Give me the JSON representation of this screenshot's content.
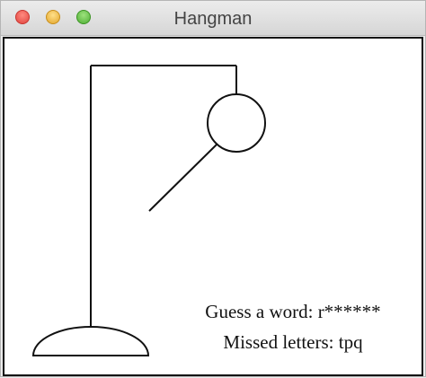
{
  "window": {
    "title": "Hangman",
    "buttons": [
      {
        "name": "close",
        "color": "#e0443e"
      },
      {
        "name": "minimize",
        "color": "#e2a52b"
      },
      {
        "name": "zoom",
        "color": "#4fae35"
      }
    ]
  },
  "game": {
    "word_label": "Guess a word:",
    "masked_word": "r******",
    "word_text": "Guess a word: r******",
    "missed_label": "Missed letters:",
    "missed_letters": "tpq",
    "missed_text": "Missed letters: tpq",
    "drawn_parts": [
      "base",
      "pole",
      "beam",
      "rope",
      "head",
      "left-arm"
    ],
    "stroke_color": "#111111"
  }
}
